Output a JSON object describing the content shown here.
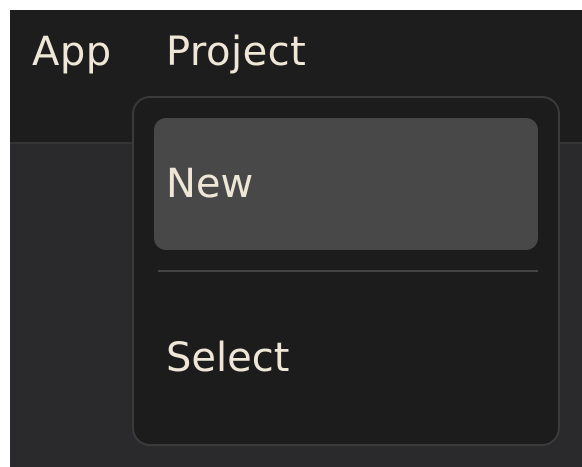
{
  "menubar": {
    "items": [
      {
        "label": "App"
      },
      {
        "label": "Project"
      }
    ]
  },
  "dropdown": {
    "items": [
      {
        "label": "New",
        "highlighted": true
      },
      {
        "label": "Select",
        "highlighted": false
      }
    ]
  },
  "colors": {
    "menubar_bg": "#1d1d1d",
    "dropdown_bg": "#1c1c1c",
    "highlight_bg": "#484848",
    "text": "#eee6d6"
  }
}
